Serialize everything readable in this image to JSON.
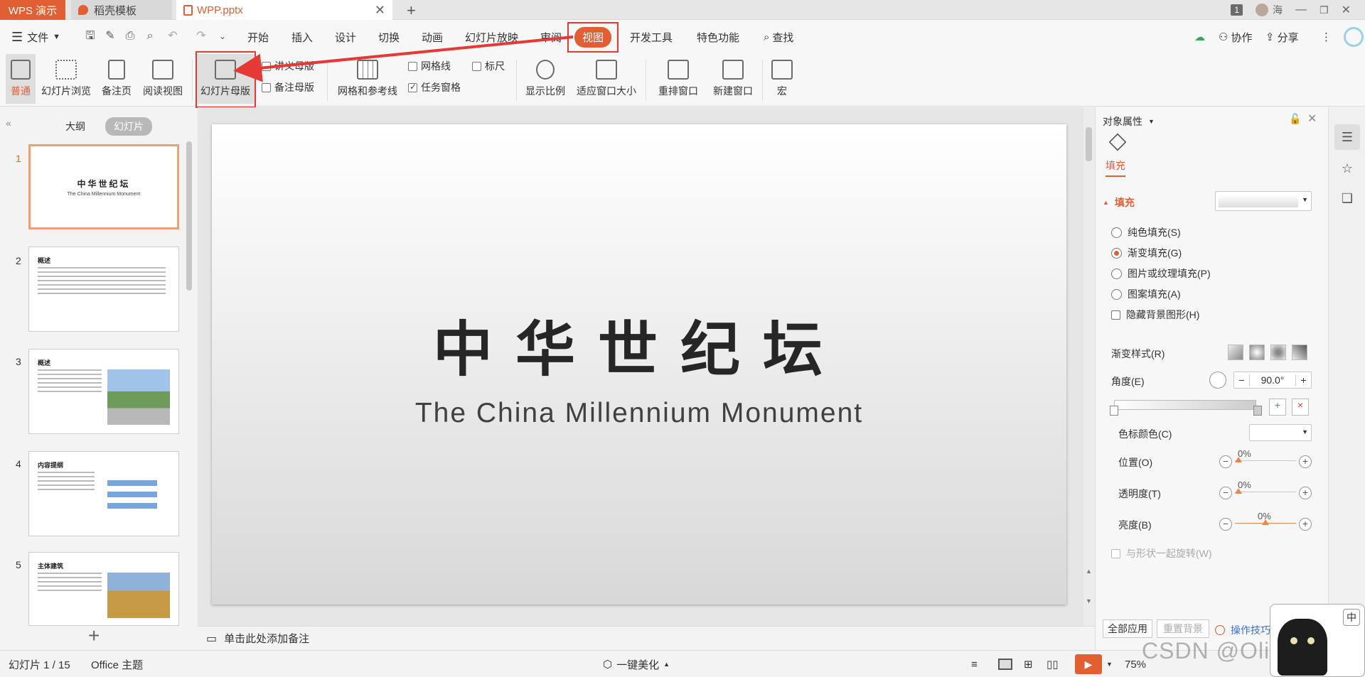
{
  "titlebar": {
    "tabs": [
      {
        "label": "WPS 演示"
      },
      {
        "label": "稻壳模板"
      },
      {
        "label": "WPP.pptx"
      }
    ],
    "window_count": "1",
    "user_name": "海"
  },
  "menu": {
    "file": "文件",
    "items": [
      "开始",
      "插入",
      "设计",
      "切换",
      "动画",
      "幻灯片放映",
      "审阅",
      "视图",
      "开发工具",
      "特色功能"
    ],
    "active": "视图",
    "search": "查找",
    "right": {
      "collab": "协作",
      "share": "分享"
    }
  },
  "ribbon": {
    "views": [
      "普通",
      "幻灯片浏览",
      "备注页",
      "阅读视图"
    ],
    "master": "幻灯片母版",
    "handout_master": "讲义母版",
    "notes_master": "备注母版",
    "grid_guides": "网格和参考线",
    "gridlines": "网格线",
    "ruler": "标尺",
    "task_pane": "任务窗格",
    "zoom": "显示比例",
    "fit_window": "适应窗口大小",
    "arrange": "重排窗口",
    "new_window": "新建窗口",
    "macro": "宏"
  },
  "left_panel": {
    "tabs": [
      "大纲",
      "幻灯片"
    ],
    "active_tab": "幻灯片",
    "thumbnails": [
      {
        "num": "1",
        "title": "中华世纪坛",
        "subtitle": "The China Millennium Monument"
      },
      {
        "num": "2",
        "title": "概述"
      },
      {
        "num": "3",
        "title": "概述"
      },
      {
        "num": "4",
        "title": "内容提纲"
      },
      {
        "num": "5",
        "title": "主体建筑"
      }
    ]
  },
  "slide": {
    "title": "中华世纪坛",
    "subtitle": "The China Millennium Monument"
  },
  "notes": {
    "placeholder": "单击此处添加备注"
  },
  "right_panel": {
    "header": "对象属性",
    "tab": "填充",
    "section": "填充",
    "options": [
      {
        "label": "纯色填充(S)",
        "selected": false
      },
      {
        "label": "渐变填充(G)",
        "selected": true
      },
      {
        "label": "图片或纹理填充(P)",
        "selected": false
      },
      {
        "label": "图案填充(A)",
        "selected": false
      }
    ],
    "hide_bg": "隐藏背景图形(H)",
    "gradient_style": "渐变样式(R)",
    "angle_label": "角度(E)",
    "angle_value": "90.0°",
    "stop_color": "色标颜色(C)",
    "position": {
      "label": "位置(O)",
      "value": "0%"
    },
    "transparency": {
      "label": "透明度(T)",
      "value": "0%"
    },
    "brightness": {
      "label": "亮度(B)",
      "value": "0%"
    },
    "rotate_with_shape": "与形状一起旋转(W)",
    "apply_all": "全部应用",
    "reset_bg": "重置背景",
    "tips": "操作技巧"
  },
  "status": {
    "slide_info": "幻灯片 1 / 15",
    "theme": "Office 主题",
    "beautify": "一键美化",
    "zoom": "75%"
  },
  "overlay": {
    "watermark": "CSDN @Oli Correct",
    "ime": "中"
  },
  "colors": {
    "accent": "#e25e33",
    "annotation": "#e53935"
  }
}
